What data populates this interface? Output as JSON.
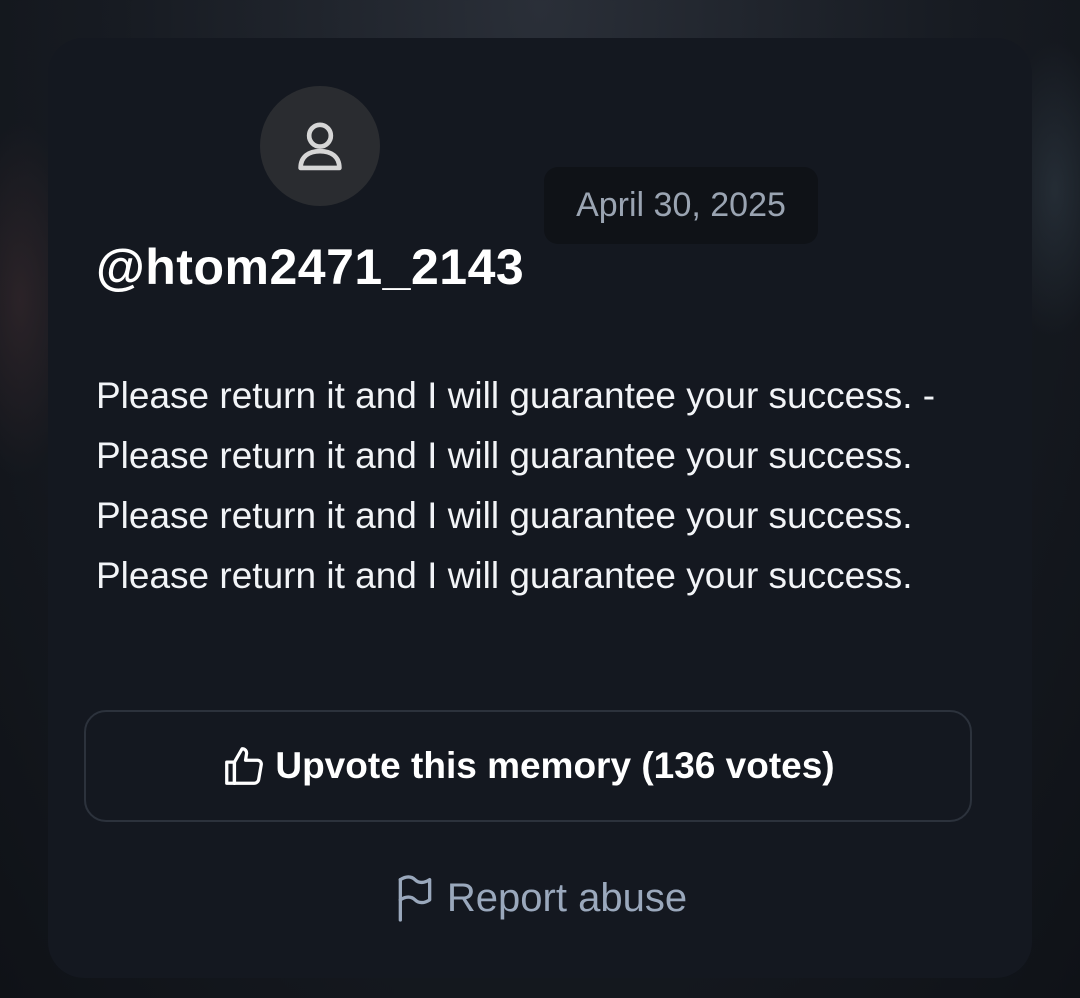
{
  "post": {
    "username": "@htom2471_2143",
    "date": "April 30, 2025",
    "message": "Please return it and I will guarantee your success. - Please return it and I will guarantee your success. Please return it and I will guarantee your success. Please return it and I will guarantee your success.",
    "avatar_icon": "user-icon"
  },
  "actions": {
    "upvote_label": "Upvote this memory (136 votes)",
    "upvote_icon": "thumbs-up-icon",
    "report_label": "Report abuse",
    "report_icon": "flag-icon"
  },
  "colors": {
    "card_background": "#141820",
    "page_background": "#171b22",
    "text_primary": "#ffffff",
    "text_muted": "#9aa4b2",
    "border": "#2c323c"
  }
}
